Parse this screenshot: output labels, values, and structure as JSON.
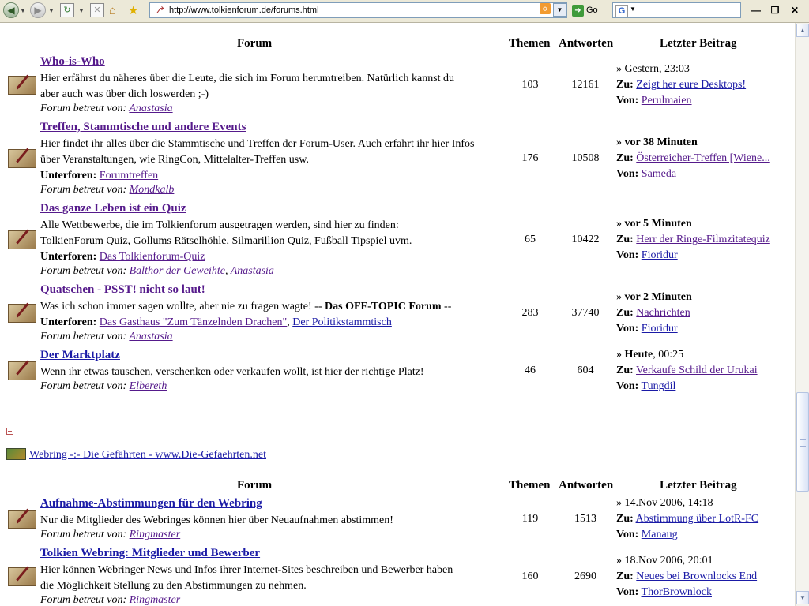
{
  "browser": {
    "url": "http://www.tolkienforum.de/forums.html",
    "go_label": "Go",
    "search_engine_glyph": "G",
    "icons": {
      "back": "back-icon",
      "forward": "forward-icon",
      "reload": "reload-icon",
      "stop": "stop-icon",
      "home": "home-icon",
      "bookmark": "star-icon",
      "rss": "rss-icon"
    }
  },
  "table_headers": {
    "forum": "Forum",
    "topics": "Themen",
    "replies": "Antworten",
    "last_post": "Letzter Beitrag"
  },
  "labels": {
    "moderated_by": "Forum betreut von:",
    "subforums": "Unterforen:",
    "to": "Zu:",
    "from": "Von:",
    "arrow": "»"
  },
  "forums_section1": [
    {
      "title": "Who-is-Who",
      "description": [
        "Hier erfährst du näheres über die Leute, die sich im Forum herumtreiben. Natürlich kannst du",
        "aber auch was über dich loswerden ;-)"
      ],
      "moderators": [
        "Anastasia"
      ],
      "topics": "103",
      "replies": "12161",
      "last_time": "Gestern, 23:03",
      "last_topic": "Zeigt her eure Desktops!",
      "last_user": "Perulmaien"
    },
    {
      "title": "Treffen, Stammtische und andere Events",
      "description": [
        "Hier findet ihr alles über die Stammtische und Treffen der Forum-User. Auch erfahrt ihr hier Infos",
        "über Veranstaltungen, wie RingCon, Mittelalter-Treffen usw."
      ],
      "subforums": [
        "Forumtreffen"
      ],
      "moderators": [
        "Mondkalb"
      ],
      "topics": "176",
      "replies": "10508",
      "last_time": "vor 38 Minuten",
      "last_topic": "Österreicher-Treffen [Wiene...",
      "last_user": "Sameda"
    },
    {
      "title": "Das ganze Leben ist ein Quiz",
      "description": [
        "Alle Wettbewerbe, die im Tolkienforum ausgetragen werden, sind hier zu finden:",
        "TolkienForum Quiz, Gollums Rätselhöhle, Silmarillion Quiz, Fußball Tipspiel uvm."
      ],
      "subforums": [
        "Das Tolkienforum-Quiz"
      ],
      "moderators": [
        "Balthor der Geweihte",
        "Anastasia"
      ],
      "topics": "65",
      "replies": "10422",
      "last_time": "vor 5 Minuten",
      "last_topic": "Herr der Ringe-Filmzitatequiz",
      "last_user": "Fioridur"
    },
    {
      "title": "Quatschen - PSST! nicht so laut!",
      "description": [
        "Was ich schon immer sagen wollte, aber nie zu fragen wagte! --"
      ],
      "description_bold": "Das OFF-TOPIC Forum",
      "description_tail": " --",
      "subforums": [
        "Das Gasthaus \"Zum Tänzelnden Drachen\"",
        "Der Politikstammtisch"
      ],
      "moderators": [
        "Anastasia"
      ],
      "topics": "283",
      "replies": "37740",
      "last_time": "vor 2 Minuten",
      "last_topic": "Nachrichten",
      "last_user": "Fioridur"
    },
    {
      "title": "Der Marktplatz",
      "description": [
        "Wenn ihr etwas tauschen, verschenken oder verkaufen wollt, ist hier der richtige Platz!"
      ],
      "moderators": [
        "Elbereth"
      ],
      "topics": "46",
      "replies": "604",
      "last_time_bold": "Heute",
      "last_time_rest": ", 00:25",
      "last_topic": "Verkaufe Schild der Urukai",
      "last_user": "Tungdil"
    }
  ],
  "webring": {
    "link": "Webring -:- Die Gefährten - www.Die-Gefaehrten.net"
  },
  "forums_section2": [
    {
      "title": "Aufnahme-Abstimmungen für den Webring",
      "description": [
        "Nur die Mitglieder des Webringes können hier über Neuaufnahmen abstimmen!"
      ],
      "moderators": [
        "Ringmaster"
      ],
      "topics": "119",
      "replies": "1513",
      "last_time": "14.Nov 2006, 14:18",
      "last_topic": "Abstimmung über LotR-FC",
      "last_user": "Manaug"
    },
    {
      "title": "Tolkien Webring: Mitglieder und Bewerber",
      "description": [
        "Hier können Webringer News und Infos ihrer Internet-Sites beschreiben und Bewerber haben",
        "die Möglichkeit Stellung zu den Abstimmungen zu nehmen."
      ],
      "moderators": [
        "Ringmaster"
      ],
      "topics": "160",
      "replies": "2690",
      "last_time": "18.Nov 2006, 20:01",
      "last_topic": "Neues bei Brownlocks End",
      "last_user": "ThorBrownlock"
    }
  ]
}
